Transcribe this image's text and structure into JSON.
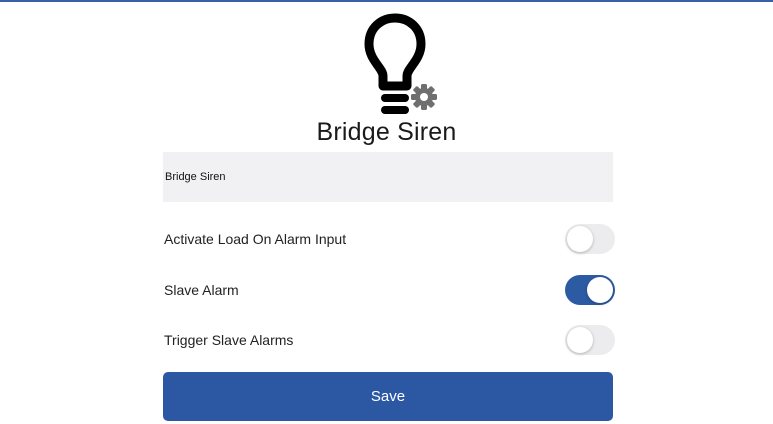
{
  "accent_color": "#2b57a3",
  "device": {
    "icon": "lightbulb-gear-icon",
    "title": "Bridge Siren"
  },
  "name_field": {
    "value": "Bridge Siren"
  },
  "settings": [
    {
      "label": "Activate Load On Alarm Input",
      "enabled": false
    },
    {
      "label": "Slave Alarm",
      "enabled": true
    },
    {
      "label": "Trigger Slave Alarms",
      "enabled": false
    }
  ],
  "save_button": {
    "label": "Save"
  }
}
